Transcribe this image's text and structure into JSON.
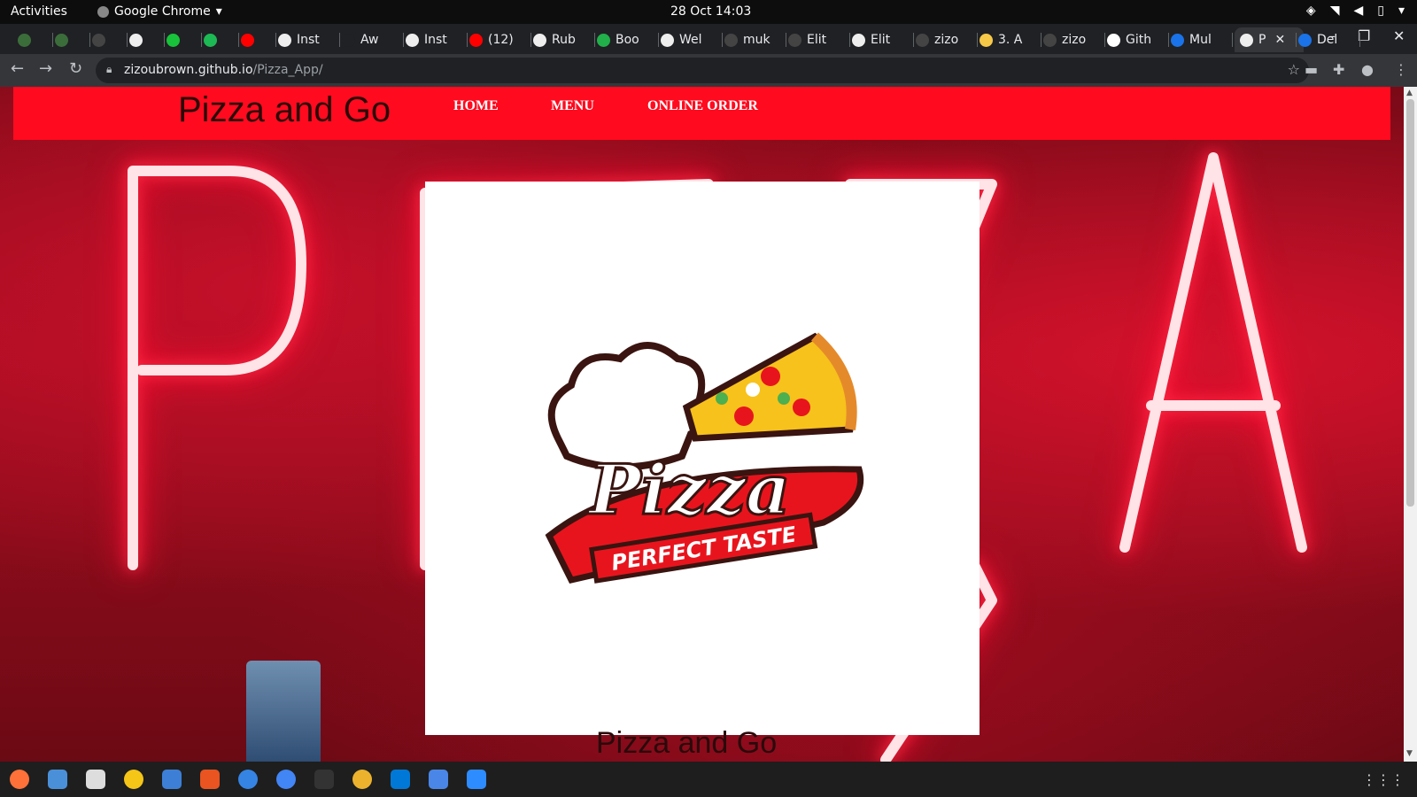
{
  "topbar": {
    "activities": "Activities",
    "app_name": "Google Chrome",
    "clock": "28 Oct  14:03"
  },
  "tabs": [
    {
      "label": "",
      "color": "#3b6d3b"
    },
    {
      "label": "",
      "color": "#3b6d3b"
    },
    {
      "label": "",
      "color": "#444"
    },
    {
      "label": "",
      "color": "#eee"
    },
    {
      "label": "",
      "color": "#18c23a"
    },
    {
      "label": "",
      "color": "#1db954"
    },
    {
      "label": "",
      "color": "#ff0000"
    },
    {
      "label": "Inst",
      "color": "#eee"
    },
    {
      "label": "Aw",
      "color": "#202124"
    },
    {
      "label": "Inst",
      "color": "#eee"
    },
    {
      "label": "(12)",
      "color": "#ff0000"
    },
    {
      "label": "Rub",
      "color": "#eee"
    },
    {
      "label": "Boo",
      "color": "#21b04a"
    },
    {
      "label": "Wel",
      "color": "#eee"
    },
    {
      "label": "muk",
      "color": "#444"
    },
    {
      "label": "Elit",
      "color": "#444"
    },
    {
      "label": "Elit",
      "color": "#eee"
    },
    {
      "label": "zizo",
      "color": "#444"
    },
    {
      "label": "3. A",
      "color": "#f7c948"
    },
    {
      "label": "zizo",
      "color": "#444"
    },
    {
      "label": "Gith",
      "color": "#fff"
    },
    {
      "label": "Mul",
      "color": "#1a73e8"
    },
    {
      "label": "P",
      "color": "#eee",
      "active": true
    },
    {
      "label": "Del",
      "color": "#1a73e8"
    }
  ],
  "address": {
    "host": "zizoubrown.github.io",
    "path": "/Pizza_App/"
  },
  "site": {
    "brand": "Pizza and Go",
    "nav": [
      "HOME",
      "MENU",
      "ONLINE ORDER"
    ],
    "logo_word": "Pizza",
    "logo_tagline": "PERFECT TASTE",
    "below_title": "Pizza and Go"
  },
  "colors": {
    "header_red": "#ff0a1e",
    "logo_red": "#e8141d",
    "logo_dark": "#3a1410"
  }
}
